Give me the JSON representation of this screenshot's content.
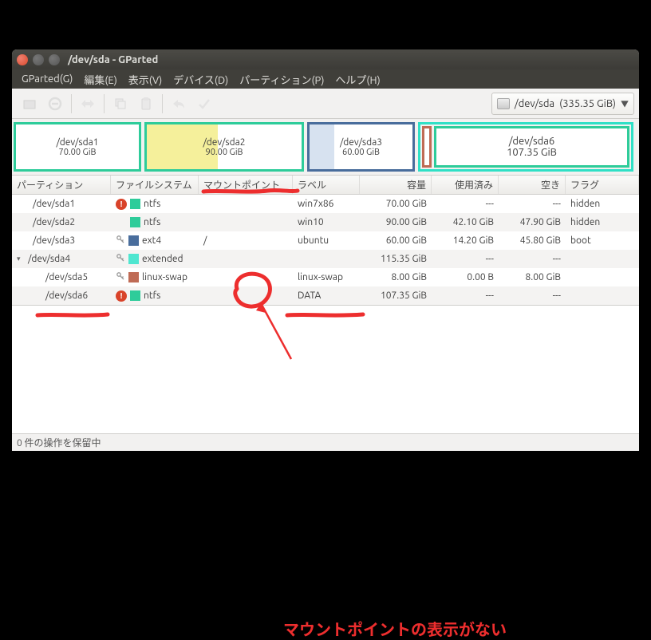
{
  "window": {
    "title": "/dev/sda - GParted"
  },
  "menubar": {
    "items": [
      "GParted(G)",
      "編集(E)",
      "表示(V)",
      "デバイス(D)",
      "パーティション(P)",
      "ヘルプ(H)"
    ]
  },
  "device_selector": {
    "device": "/dev/sda",
    "size": "(335.35 GiB)"
  },
  "graph": {
    "sda1": {
      "name": "/dev/sda1",
      "size": "70.00 GiB"
    },
    "sda2": {
      "name": "/dev/sda2",
      "size": "90.00 GiB"
    },
    "sda3": {
      "name": "/dev/sda3",
      "size": "60.00 GiB"
    },
    "sda6": {
      "name": "/dev/sda6",
      "size": "107.35 GiB"
    }
  },
  "table": {
    "headers": {
      "partition": "パーティション",
      "filesystem": "ファイルシステム",
      "mountpoint": "マウントポイント",
      "label": "ラベル",
      "size": "容量",
      "used": "使用済み",
      "free": "空き",
      "flags": "フラグ"
    },
    "rows": [
      {
        "name": "/dev/sda1",
        "indent": 1,
        "warn": true,
        "key": false,
        "fs": "ntfs",
        "fs_class": "ntfs",
        "mount": "",
        "label": "win7x86",
        "size": "70.00 GiB",
        "used": "---",
        "free": "---",
        "flags": "hidden"
      },
      {
        "name": "/dev/sda2",
        "indent": 1,
        "warn": false,
        "key": false,
        "fs": "ntfs",
        "fs_class": "ntfs",
        "mount": "",
        "label": "win10",
        "size": "90.00 GiB",
        "used": "42.10 GiB",
        "free": "47.90 GiB",
        "flags": "hidden"
      },
      {
        "name": "/dev/sda3",
        "indent": 1,
        "warn": false,
        "key": true,
        "fs": "ext4",
        "fs_class": "ext4",
        "mount": "/",
        "label": "ubuntu",
        "size": "60.00 GiB",
        "used": "14.20 GiB",
        "free": "45.80 GiB",
        "flags": "boot"
      },
      {
        "name": "/dev/sda4",
        "indent": 0,
        "expander": "▾",
        "warn": false,
        "key": true,
        "fs": "extended",
        "fs_class": "extd",
        "mount": "",
        "label": "",
        "size": "115.35 GiB",
        "used": "---",
        "free": "---",
        "flags": ""
      },
      {
        "name": "/dev/sda5",
        "indent": 2,
        "warn": false,
        "key": true,
        "fs": "linux-swap",
        "fs_class": "swap",
        "mount": "",
        "label": "linux-swap",
        "size": "8.00 GiB",
        "used": "0.00 B",
        "free": "8.00 GiB",
        "flags": ""
      },
      {
        "name": "/dev/sda6",
        "indent": 2,
        "warn": true,
        "key": false,
        "fs": "ntfs",
        "fs_class": "ntfs",
        "mount": "",
        "label": "DATA",
        "size": "107.35 GiB",
        "used": "---",
        "free": "---",
        "flags": ""
      }
    ]
  },
  "statusbar": {
    "text": "0 件の操作を保留中"
  },
  "annotation": {
    "text": "マウントポイントの表示がない"
  }
}
